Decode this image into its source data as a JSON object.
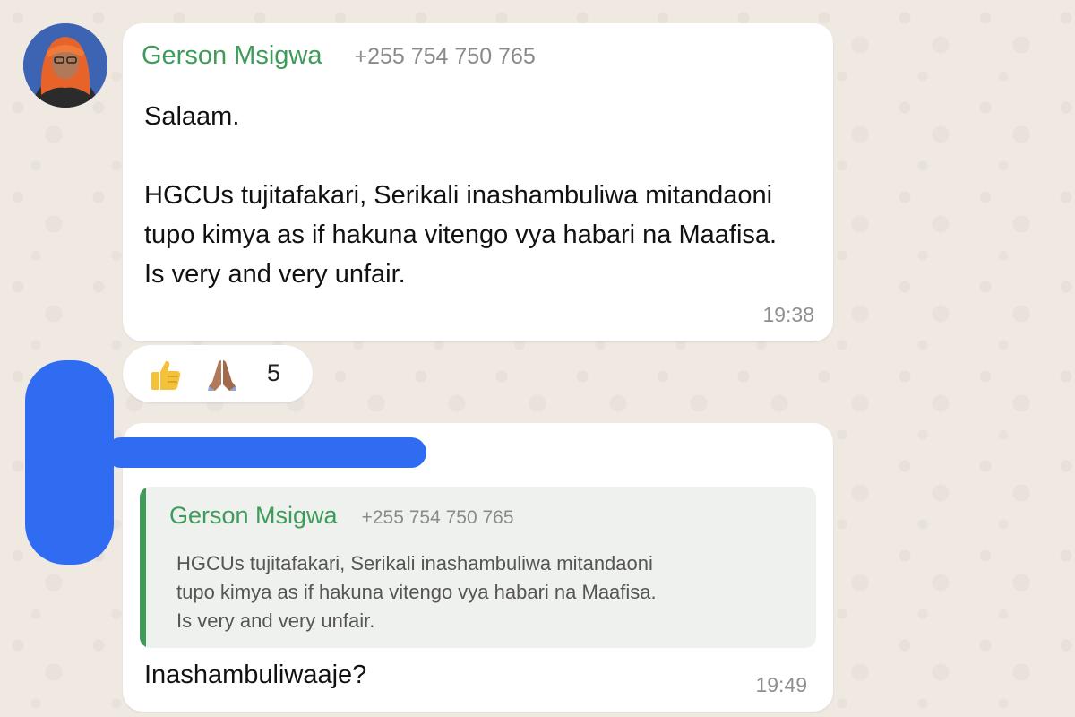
{
  "message1": {
    "sender": "Gerson Msigwa",
    "phone": "+255 754 750 765",
    "lines": [
      "Salaam.",
      "",
      "HGCUs tujitafakari, Serikali inashambuliwa mitandaoni",
      "tupo kimya as if hakuna vitengo vya habari na Maafisa.",
      "Is very and very unfair."
    ],
    "time": "19:38"
  },
  "reactions": {
    "emojis": [
      "thumbs-up-emoji",
      "folded-hands-emoji"
    ],
    "count": "5"
  },
  "message2": {
    "quoted": {
      "sender": "Gerson Msigwa",
      "phone": "+255 754 750 765",
      "lines": [
        "HGCUs tujitafakari, Serikali inashambuliwa mitandaoni",
        "tupo kimya as if hakuna vitengo vya habari na Maafisa.",
        "Is very and very unfair."
      ]
    },
    "text": "Inashambuliwaaje?",
    "time": "19:49"
  },
  "colors": {
    "sender_green": "#3f9b5a",
    "redaction_blue": "#2f6cf2",
    "chat_background": "#efe9e2"
  }
}
